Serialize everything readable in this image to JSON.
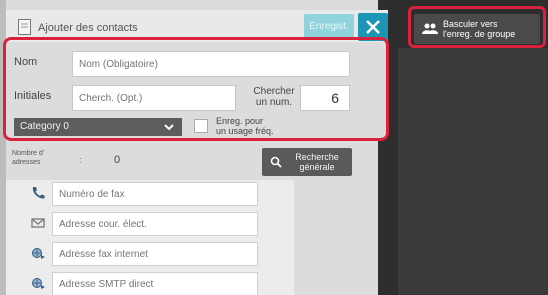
{
  "header": {
    "title": "Ajouter des contacts",
    "save_label": "Enregist.",
    "close_icon": "close-icon"
  },
  "group_switch": {
    "label_line1": "Basculer vers",
    "label_line2": "l'enreg. de groupe",
    "icon": "group-icon"
  },
  "form": {
    "name_label": "Nom",
    "name_placeholder": "Nom (Obligatoire)",
    "initials_label": "Initiales",
    "initials_placeholder": "Cherch. (Opt.)",
    "search_num_label_line1": "Chercher",
    "search_num_label_line2": "un num.",
    "search_num_value": "6",
    "category_value": "Category 0",
    "favorite_label_line1": "Enreg. pour",
    "favorite_label_line2": "un usage fréq."
  },
  "address_count": {
    "label_line1": "Nombre d'",
    "label_line2": "adresses",
    "separator": ":",
    "value": "0"
  },
  "global_search": {
    "label_line1": "Recherche",
    "label_line2": "générale",
    "icon": "search-icon"
  },
  "addresses": [
    {
      "icon": "fax-icon",
      "placeholder": "Numéro de fax"
    },
    {
      "icon": "email-icon",
      "placeholder": "Adresse cour. élect."
    },
    {
      "icon": "internet-fax-icon",
      "placeholder": "Adresse fax internet"
    },
    {
      "icon": "smtp-icon",
      "placeholder": "Adresse SMTP direct"
    }
  ],
  "colors": {
    "accent": "#1b96b4",
    "highlight": "#d9223b"
  }
}
